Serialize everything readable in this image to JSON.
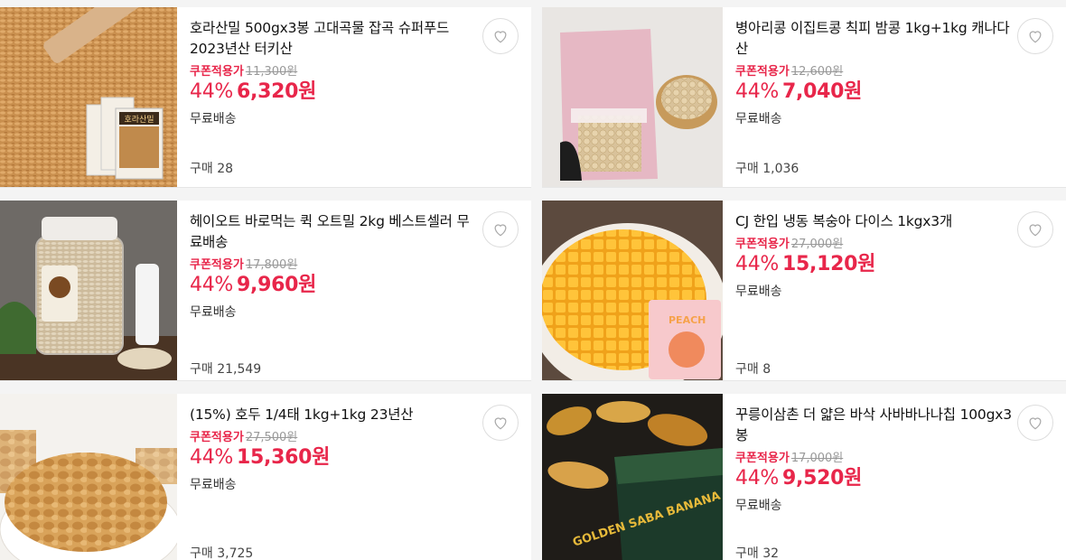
{
  "products": [
    {
      "title": "호라산밀 500gx3봉 고대곡물 잡곡 슈퍼푸드 2023년산 터키산",
      "coupon_label": "쿠폰적용가",
      "original_price": "11,300원",
      "discount": "44%",
      "price": "6,320원",
      "shipping": "무료배송",
      "sold": "구매 28",
      "image_text": "호라산밀"
    },
    {
      "title": "병아리콩 이집트콩 칙피 밤콩 1kg+1kg 캐나다산",
      "coupon_label": "쿠폰적용가",
      "original_price": "12,600원",
      "discount": "44%",
      "price": "7,040원",
      "shipping": "무료배송",
      "sold": "구매 1,036",
      "image_text": ""
    },
    {
      "title": "헤이오트 바로먹는 퀵 오트밀 2kg 베스트셀러 무료배송",
      "coupon_label": "쿠폰적용가",
      "original_price": "17,800원",
      "discount": "44%",
      "price": "9,960원",
      "shipping": "무료배송",
      "sold": "구매 21,549",
      "image_text": ""
    },
    {
      "title": "CJ 한입 냉동 복숭아 다이스 1kgx3개",
      "coupon_label": "쿠폰적용가",
      "original_price": "27,000원",
      "discount": "44%",
      "price": "15,120원",
      "shipping": "무료배송",
      "sold": "구매 8",
      "image_text": "PEACH"
    },
    {
      "title": "(15%) 호두 1/4태 1kg+1kg 23년산",
      "coupon_label": "쿠폰적용가",
      "original_price": "27,500원",
      "discount": "44%",
      "price": "15,360원",
      "shipping": "무료배송",
      "sold": "구매 3,725",
      "image_text": ""
    },
    {
      "title": "꾸릉이삼촌 더 얇은 바삭 사바바나나칩 100gx3봉",
      "coupon_label": "쿠폰적용가",
      "original_price": "17,000원",
      "discount": "44%",
      "price": "9,520원",
      "shipping": "무료배송",
      "sold": "구매 32",
      "image_text": "GOLDEN SABA BANANA CHIPS"
    }
  ],
  "colors": {
    "accent": "#e8264a",
    "strike": "#999999"
  },
  "icons": {
    "wish": "heart-outline-icon"
  }
}
